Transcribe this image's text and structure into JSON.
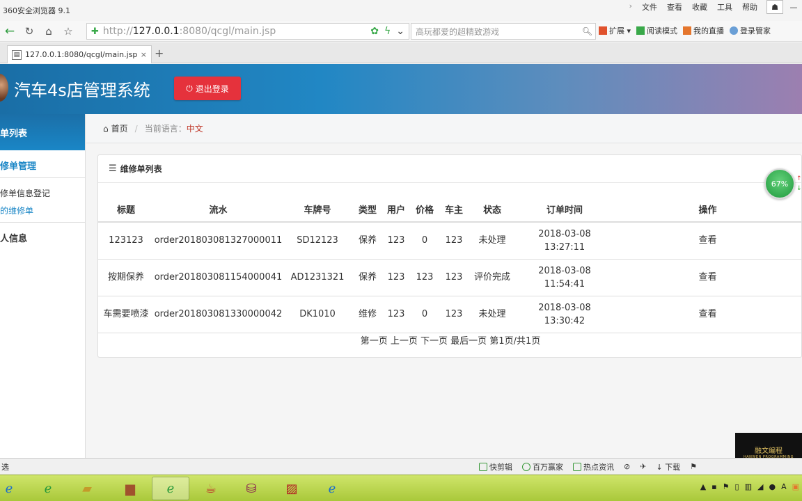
{
  "browser": {
    "title": "360安全浏览器 9.1",
    "menus": [
      "文件",
      "查看",
      "收藏",
      "工具",
      "帮助"
    ],
    "url": {
      "proto": "http://",
      "host": "127.0.0.1",
      "rest": ":8080/qcgl/main.jsp"
    },
    "search_placeholder": "高玩都爱的超精致游戏",
    "tools": [
      "扩展",
      "阅读模式",
      "我的直播",
      "登录管家"
    ],
    "tab_title": "127.0.0.1:8080/qcgl/main.jsp"
  },
  "app": {
    "name": "汽车4s店管理系统",
    "logout_label": "退出登录"
  },
  "sidebar": {
    "header": "单列表",
    "group1": "修单管理",
    "item1": "修单信息登记",
    "item2": "的维修单",
    "group2": "人信息"
  },
  "breadcrumb": {
    "home": "首页",
    "lang_label": "当前语言：",
    "lang_value": "中文"
  },
  "panel": {
    "title": "维修单列表",
    "columns": [
      "标题",
      "流水",
      "车牌号",
      "类型",
      "用户",
      "价格",
      "车主",
      "状态",
      "订单时间",
      "操作"
    ],
    "rows": [
      {
        "title": "123123",
        "serial": "order201803081327000011",
        "plate": "SD12123",
        "type": "保养",
        "user": "123",
        "price": "0",
        "owner": "123",
        "status": "未处理",
        "date": "2018-03-08",
        "time": "13:27:11",
        "action": "查看"
      },
      {
        "title": "按期保养",
        "serial": "order201803081154000041",
        "plate": "AD1231321",
        "type": "保养",
        "user": "123",
        "price": "123",
        "owner": "123",
        "status": "评价完成",
        "date": "2018-03-08",
        "time": "11:54:41",
        "action": "查看"
      },
      {
        "title": "车需要喷漆",
        "serial": "order201803081330000042",
        "plate": "DK1010",
        "type": "维修",
        "user": "123",
        "price": "0",
        "owner": "123",
        "status": "未处理",
        "date": "2018-03-08",
        "time": "13:30:42",
        "action": "查看"
      }
    ],
    "pager": "第一页 上一页 下一页 最后一页 第1页/共1页"
  },
  "gauge": {
    "value": "67%"
  },
  "statusbar": {
    "left": "选",
    "items": [
      "快剪辑",
      "百万赢家",
      "热点资讯",
      "下载"
    ]
  },
  "watermark": {
    "big": "融文编程",
    "small": "HANWEN PROGRAMMING"
  }
}
